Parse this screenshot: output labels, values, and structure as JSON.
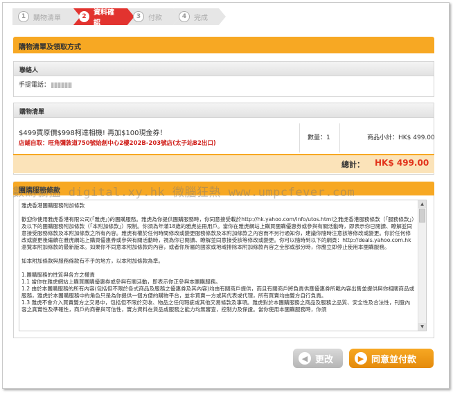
{
  "steps": [
    {
      "num": "1",
      "label": "購物清單"
    },
    {
      "num": "2",
      "label": "資料確認"
    },
    {
      "num": "3",
      "label": "付款"
    },
    {
      "num": "4",
      "label": "完成"
    }
  ],
  "section_title": "購物清單及領取方式",
  "contact": {
    "header": "聯絡人",
    "phone_label": "手提電話："
  },
  "cart": {
    "header": "購物清單",
    "item_title": "$499買原價$998柯達相機! 再加$100現金券！",
    "pickup": "店鋪自取：旺角彌敦道750號始創中心2樓202B-203號店(太子站B2出口)",
    "qty_label": "數量：1",
    "subtotal_label": "商品小計：HK$ 499.00",
    "total_label": "總計：",
    "total_value": "HK$  499.00"
  },
  "terms": {
    "header": "團購服務條款",
    "lines": [
      "雅虎香港團購服務附加條款",
      "",
      "歡迎你使用雅虎香港有限公司(「雅虎」)的團購服務。雅虎為你提供團購服務時，你同意接受載於http://hk.yahoo.com/info/utos.html之雅虎香港服務條款（「服務條款」）及以下的團購服務附加條款（「本附加條款」）限制。你須為年滿18歲的雅虎註冊用戶。當你在雅虎網站上購買團購優惠券或參與有關活動時，即表示你已閱讀、瞭解並同意接受服務條款及本附加條款之所有內容。雅虎有權於任何時間修改或變更服務條款及本附加條款之內容而不另行通知你，建議你隨時注意該等修改或變更。你於任何修改或變更後繼續在雅虎網站上購買優惠券或參與有關活動時，視為你已閱讀、瞭解並同意接受該等修改或變更。你可以隨時到以下的網頁：http://deals.yahoo.com.hk瀏覽本附加條款的最新版本。如果你不同意本附加條款的內容，或者你所屬的國家或地域排除本附加條款內容之全部或部分時，你應立即停止使用本團購服務。",
      "",
      "如本附加條款與服務條款有不乎的地方，以本附加條款為準。",
      "",
      "1.團購服務的性質與各方之權責",
      "1.1 當你在雅虎網站上購買團購優惠券或參與有關活動，即表示你正參與本團購服務。",
      "1.2 由於本團購服務的所有內容(包括但不限於各式商品及服務之優惠券及其內容)均由有關商戶提供，而且有關商戶將負責供應優惠券所載內容出售並提供與你相關商品或服務，雅虎於本團購服務中的角色只是為你提供一個方便的購物平台，並非買賣一方或其代表或代理，所有買賣均由雙方自行負責。",
      "1.3 雅虎不會介入買賣雙方之交易中，包括但不限於交收、物品之任何瑕疵或其他交易條款及事項。雅虎對於本團購服務之商品及服務之品質、安全性及合法性，刊登內容之真實性及準確性，商戶的商譽與可信性，實方資料在貨品或服務之能力均無審查，控制力及保證。當你使用本團購服務時，你須"
    ]
  },
  "watermark": "數碼櫥搵 digital.xy.hk 微腦狂熱 www.umpcfever.com",
  "buttons": {
    "back": "更改",
    "confirm": "同意並付款"
  }
}
